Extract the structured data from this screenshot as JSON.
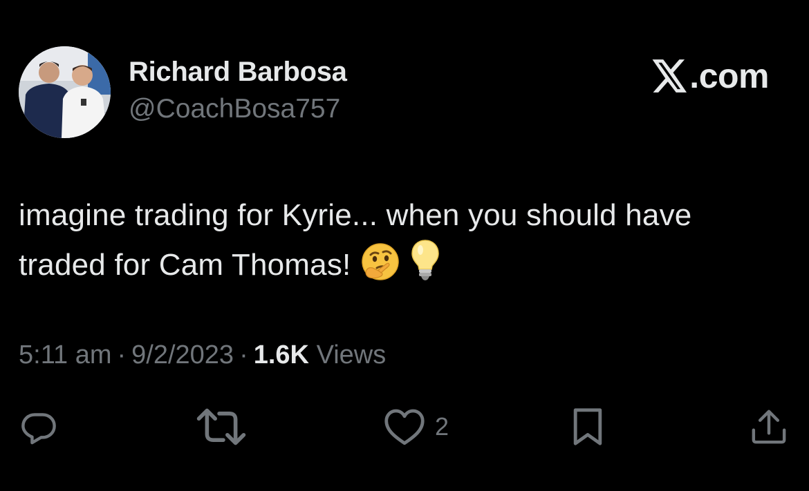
{
  "author": {
    "display_name": "Richard Barbosa",
    "handle": "@CoachBosa757"
  },
  "site": {
    "logo_suffix": ".com"
  },
  "tweet": {
    "text_line1": "imagine trading for Kyrie... when you should have",
    "text_line2": "traded for Cam Thomas!",
    "emojis": [
      "thinking-face-emoji",
      "light-bulb-emoji"
    ]
  },
  "meta": {
    "time": "5:11 am",
    "separator": "·",
    "date": "9/2/2023",
    "views_count": "1.6K",
    "views_label": "Views"
  },
  "actions": {
    "like_count": "2",
    "icons": [
      "reply-icon",
      "retweet-icon",
      "like-icon",
      "bookmark-icon",
      "share-icon"
    ]
  },
  "colors": {
    "background": "#000000",
    "primary_text": "#e7e9ea",
    "secondary_text": "#71767b"
  }
}
